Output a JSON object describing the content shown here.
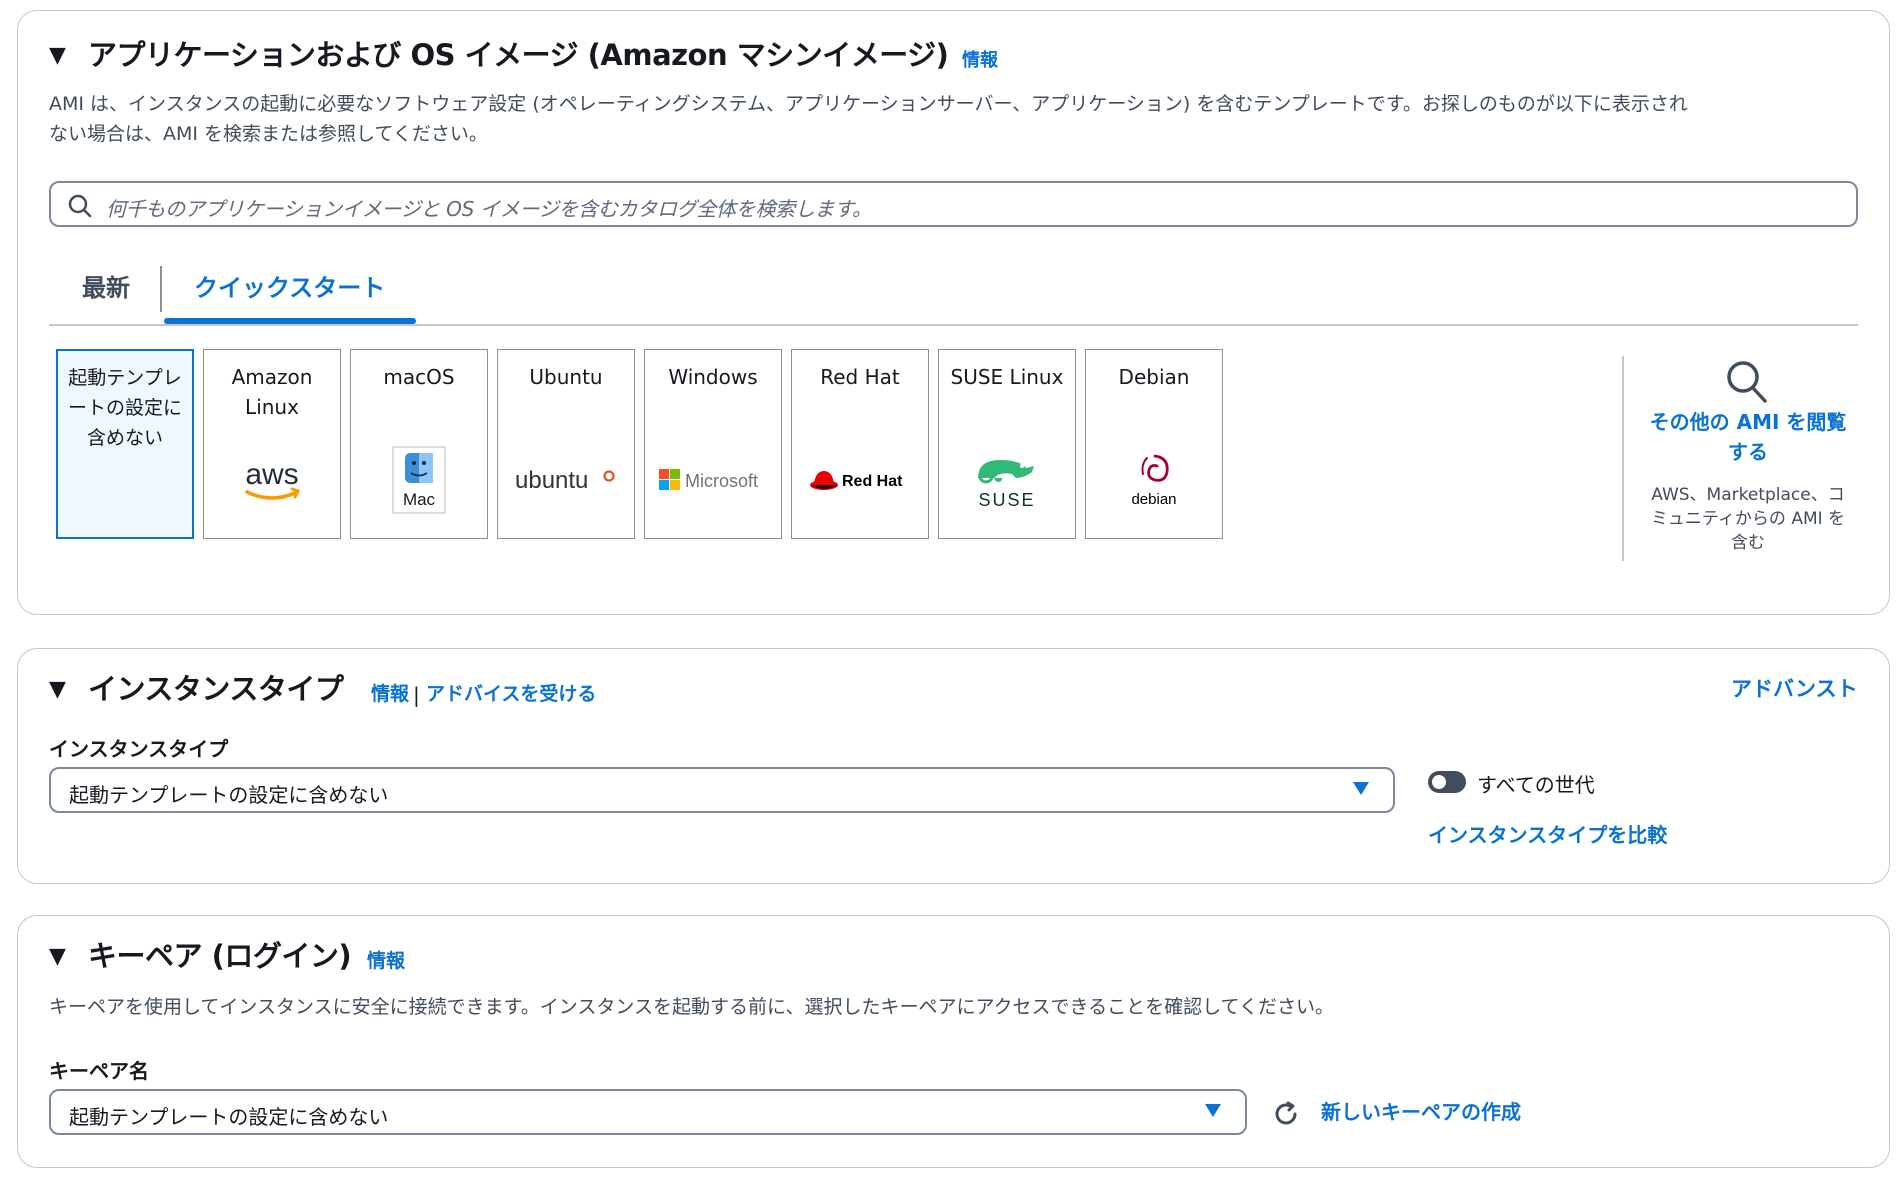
{
  "ami": {
    "title": "アプリケーションおよび OS イメージ (Amazon マシンイメージ)",
    "info": "情報",
    "desc_line1": "AMI は、インスタンスの起動に必要なソフトウェア設定 (オペレーティングシステム、アプリケーションサーバー、アプリケーション) を含むテンプレートです。お探しのものが以下に表示され",
    "desc_line2": "ない場合は、AMI を検索または参照してください。",
    "search_placeholder": "何千ものアプリケーションイメージと OS イメージを含むカタログ全体を検索します。",
    "tabs": [
      {
        "label": "最新",
        "active": false
      },
      {
        "label": "クイックスタート",
        "active": true
      }
    ],
    "tiles": [
      {
        "label": "起動テンプレートの設定に含めない",
        "selected": true
      },
      {
        "label": "Amazon Linux",
        "logo_text": "aws"
      },
      {
        "label": "macOS",
        "logo_text": "Mac"
      },
      {
        "label": "Ubuntu",
        "logo_text": "ubuntu"
      },
      {
        "label": "Windows",
        "logo_text": "Microsoft"
      },
      {
        "label": "Red Hat",
        "logo_text": "Red Hat"
      },
      {
        "label": "SUSE Linux",
        "logo_text": "SUSE"
      },
      {
        "label": "Debian",
        "logo_text": "debian"
      }
    ],
    "browse_link": "その他の AMI を閲覧する",
    "browse_sub": "AWS、Marketplace、コミュニティからの AMI を含む"
  },
  "instance": {
    "title": "インスタンスタイプ",
    "info": "情報",
    "sep": "|",
    "advice": "アドバイスを受ける",
    "advanced": "アドバンスト",
    "field_label": "インスタンスタイプ",
    "select_value": "起動テンプレートの設定に含めない",
    "toggle_label": "すべての世代",
    "toggle_on": false,
    "compare_link": "インスタンスタイプを比較"
  },
  "keypair": {
    "title": "キーペア (ログイン)",
    "info": "情報",
    "desc": "キーペアを使用してインスタンスに安全に接続できます。インスタンスを起動する前に、選択したキーペアにアクセスできることを確認してください。",
    "field_label": "キーペア名",
    "select_value": "起動テンプレートの設定に含めない",
    "create_link": "新しいキーペアの作成"
  },
  "colors": {
    "link": "#0972d3",
    "border": "#7d8998",
    "selected_bg": "#f0f8ff",
    "text": "#16191f"
  }
}
